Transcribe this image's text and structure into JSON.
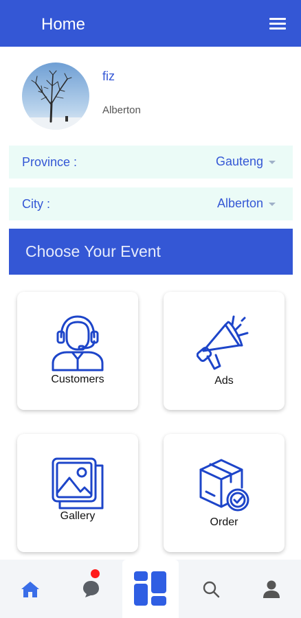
{
  "header": {
    "title": "Home",
    "menu_icon": "hamburger-menu-icon"
  },
  "profile": {
    "name": "fiz",
    "location": "Alberton"
  },
  "filters": {
    "province": {
      "label": "Province :",
      "value": "Gauteng"
    },
    "city": {
      "label": "City :",
      "value": "Alberton"
    }
  },
  "banner": {
    "text": "Choose Your Event"
  },
  "cards": [
    {
      "label": "Customers",
      "icon": "customer-support-icon"
    },
    {
      "label": "Ads",
      "icon": "megaphone-icon"
    },
    {
      "label": "Gallery",
      "icon": "gallery-icon"
    },
    {
      "label": "Order",
      "icon": "box-check-icon"
    }
  ],
  "bottom_nav": [
    {
      "icon": "home-icon",
      "active": true
    },
    {
      "icon": "chat-icon",
      "badge": true
    },
    {
      "icon": "dashboard-icon",
      "active": true
    },
    {
      "icon": "search-icon"
    },
    {
      "icon": "profile-icon"
    }
  ],
  "colors": {
    "primary": "#3457d5",
    "filter_bg": "#ebfbf7",
    "badge": "#ff1a1a"
  }
}
